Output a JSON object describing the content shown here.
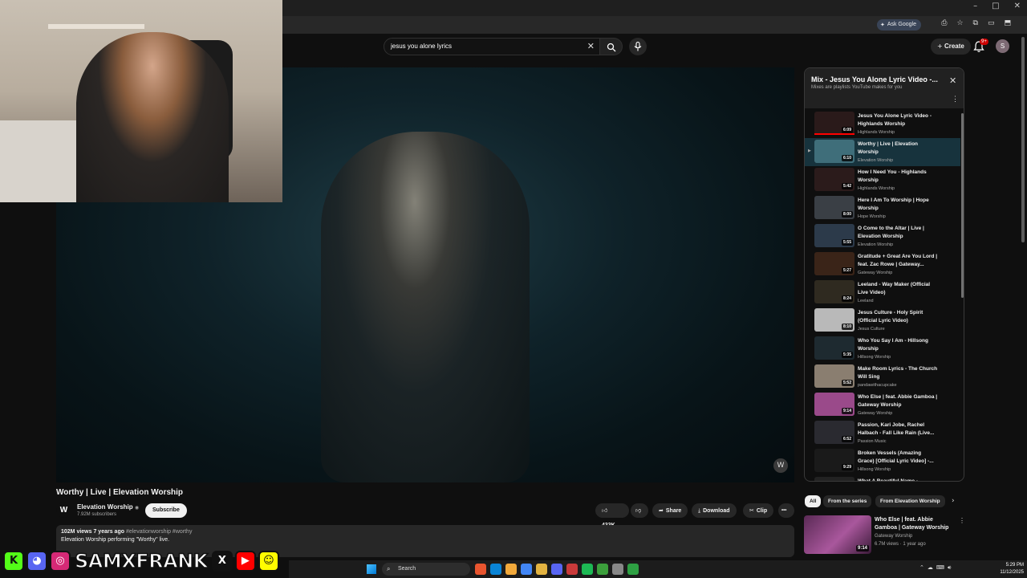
{
  "browser": {
    "ask_google": "Ask Google",
    "window_controls": [
      "–",
      "□",
      "✕"
    ],
    "toolbar_icons": [
      "⎙",
      "☆",
      "⧉",
      "▭",
      "⬒"
    ]
  },
  "header": {
    "search_value": "jesus you alone lyrics",
    "clear_icon": "✕",
    "create_label": "Create",
    "notification_badge": "9+",
    "avatar_letter": "S"
  },
  "video": {
    "title": "Worthy | Live | Elevation Worship",
    "channel_name": "Elevation Worship",
    "channel_verified": "◉",
    "subscribers": "7.92M subscribers",
    "subscribe_label": "Subscribe",
    "likes": "433K",
    "share_label": "Share",
    "download_label": "Download",
    "clip_label": "Clip",
    "more_label": "•••",
    "views_age": "102M views  7 years ago",
    "tags": "#elevationworship #worthy",
    "description": "Elevation Worship performing \"Worthy\" live."
  },
  "playlist": {
    "title": "Mix - Jesus You Alone Lyric Video -...",
    "subtitle": "Mixes are playlists YouTube makes for you",
    "close_icon": "✕",
    "items": [
      {
        "title": "Jesus You Alone Lyric Video - Highlands Worship",
        "channel": "Highlands Worship",
        "duration": "6:09",
        "thumb": "#2a1a1a",
        "progress": 1
      },
      {
        "title": "Worthy | Live | Elevation Worship",
        "channel": "Elevation Worship",
        "duration": "6:10",
        "thumb": "#3f6e7a",
        "active": true
      },
      {
        "title": "How I Need You - Highlands Worship",
        "channel": "Highlands Worship",
        "duration": "5:42",
        "thumb": "#2b1b1b"
      },
      {
        "title": "Here I Am To Worship | Hope Worship",
        "channel": "Hope Worship",
        "duration": "8:00",
        "thumb": "#3a3f45"
      },
      {
        "title": "O Come to the Altar | Live | Elevation Worship",
        "channel": "Elevation Worship",
        "duration": "5:55",
        "thumb": "#2c3a4a"
      },
      {
        "title": "Gratitude + Great Are You Lord | feat. Zac Rowe | Gateway...",
        "channel": "Gateway Worship",
        "duration": "5:27",
        "thumb": "#3a2418"
      },
      {
        "title": "Leeland - Way Maker (Official Live Video)",
        "channel": "Leeland",
        "duration": "8:24",
        "thumb": "#2f2a20"
      },
      {
        "title": "Jesus Culture - Holy Spirit (Official Lyric Video)",
        "channel": "Jesus Culture",
        "duration": "8:10",
        "thumb": "#b9b9b9"
      },
      {
        "title": "Who You Say I Am - Hillsong Worship",
        "channel": "Hillsong Worship",
        "duration": "5:35",
        "thumb": "#1e2a30"
      },
      {
        "title": "Make Room Lyrics - The Church Will Sing",
        "channel": "pandawithacupcake",
        "duration": "5:52",
        "thumb": "#8a7e70"
      },
      {
        "title": "Who Else | feat. Abbie Gamboa | Gateway Worship",
        "channel": "Gateway Worship",
        "duration": "9:14",
        "thumb": "#9a4a8a"
      },
      {
        "title": "Passion, Kari Jobe, Rachel Halbach - Fall Like Rain (Live...",
        "channel": "Passion Music",
        "duration": "6:52",
        "thumb": "#2a2a30"
      },
      {
        "title": "Broken Vessels (Amazing Grace) [Official Lyric Video] -...",
        "channel": "Hillsong Worship",
        "duration": "9:29",
        "thumb": "#1a1a1a"
      },
      {
        "title": "What A Beautiful Name -",
        "channel": "",
        "duration": "",
        "thumb": "#222"
      }
    ]
  },
  "chips": [
    "All",
    "From the series",
    "From Elevation Worship"
  ],
  "recommended": {
    "title": "Who Else | feat. Abbie Gamboa | Gateway Worship",
    "channel": "Gateway Worship",
    "meta": "6.7M views · 1 year ago",
    "duration": "9:14"
  },
  "overlay": {
    "streamer_name": "SAMXFRANK",
    "social_icons": [
      {
        "name": "kick-icon",
        "glyph": "K",
        "color": "#53fc18"
      },
      {
        "name": "discord-icon",
        "glyph": "◕",
        "color": "#5865f2"
      },
      {
        "name": "instagram-icon",
        "glyph": "◎",
        "color": "#d62976"
      },
      {
        "name": "x-icon",
        "glyph": "X",
        "color": "#111111"
      },
      {
        "name": "youtube-icon",
        "glyph": "▶",
        "color": "#ff0000"
      },
      {
        "name": "snapchat-icon",
        "glyph": "☺",
        "color": "#fffc00"
      }
    ]
  },
  "taskbar": {
    "search_label": "Search",
    "time": "5:29 PM",
    "date": "11/12/2025",
    "apps": [
      "#e9552f",
      "#0a84d6",
      "#f2a93b",
      "#4286f5",
      "#e3b341",
      "#5865f2",
      "#c93a3a",
      "#1db954",
      "#3c9f3c",
      "#888888",
      "#2ea043"
    ]
  },
  "colors": {
    "accent_red": "#ff0000",
    "active_row": "#17333d",
    "subscribe_bg": "#f1f1f1"
  }
}
